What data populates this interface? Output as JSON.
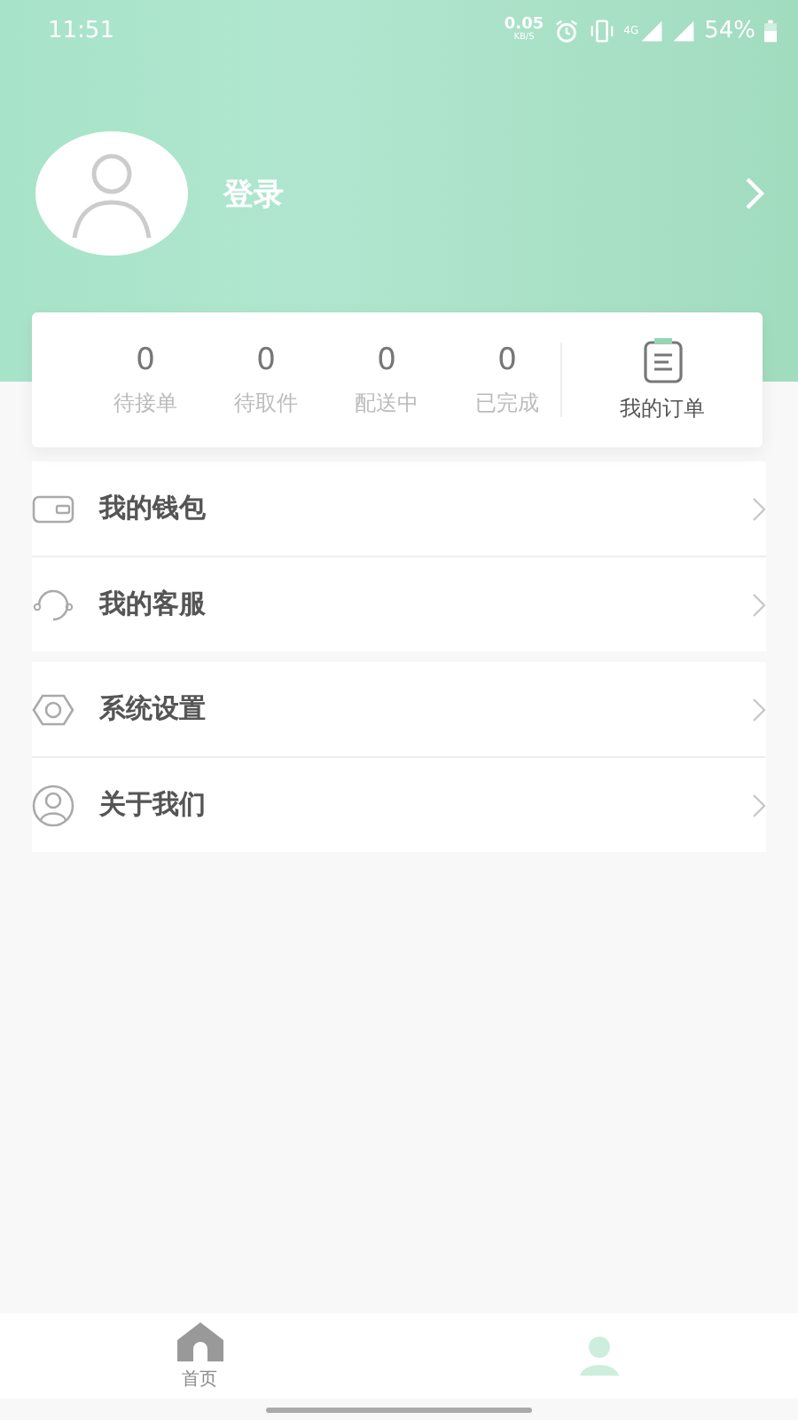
{
  "status_bar": {
    "time": "11:51",
    "speed": "0.05",
    "speed_unit": "KB/S",
    "network": "4G",
    "battery": "54%"
  },
  "profile": {
    "login_label": "登录"
  },
  "orders": {
    "stats": [
      {
        "count": "0",
        "label": "待接单"
      },
      {
        "count": "0",
        "label": "待取件"
      },
      {
        "count": "0",
        "label": "配送中"
      },
      {
        "count": "0",
        "label": "已完成"
      }
    ],
    "my_orders_label": "我的订单"
  },
  "menu_groups": [
    [
      {
        "kind": "wallet",
        "label": "我的钱包"
      },
      {
        "kind": "headset",
        "label": "我的客服"
      }
    ],
    [
      {
        "kind": "settings",
        "label": "系统设置"
      },
      {
        "kind": "about",
        "label": "关于我们"
      }
    ]
  ],
  "tab_bar": [
    {
      "kind": "home",
      "label": "首页",
      "selected": false
    },
    {
      "kind": "profile",
      "selected": true
    }
  ]
}
